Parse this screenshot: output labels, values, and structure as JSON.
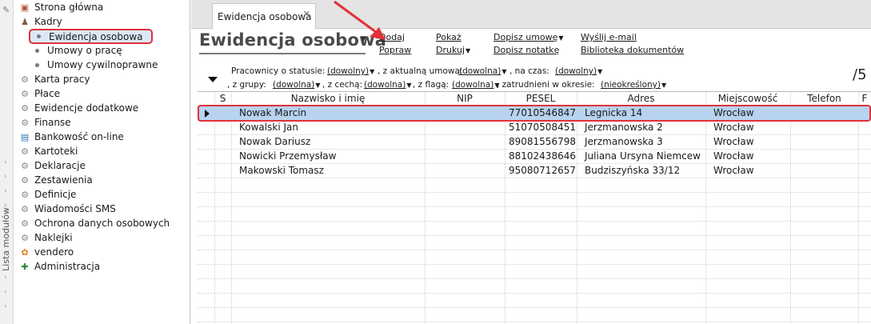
{
  "rail": {
    "label": "Lista modułów"
  },
  "sidebar": {
    "items": [
      {
        "label": "Strona główna",
        "icon": "home-icon"
      },
      {
        "label": "Kadry",
        "icon": "people-icon"
      },
      {
        "label": "Karta pracy",
        "icon": "gear-icon"
      },
      {
        "label": "Płace",
        "icon": "gear-icon"
      },
      {
        "label": "Ewidencje dodatkowe",
        "icon": "gear-icon"
      },
      {
        "label": "Finanse",
        "icon": "finance-icon"
      },
      {
        "label": "Bankowość on-line",
        "icon": "bank-icon"
      },
      {
        "label": "Kartoteki",
        "icon": "gear-icon"
      },
      {
        "label": "Deklaracje",
        "icon": "document-icon"
      },
      {
        "label": "Zestawienia",
        "icon": "gear-icon"
      },
      {
        "label": "Definicje",
        "icon": "gear-icon"
      },
      {
        "label": "Wiadomości SMS",
        "icon": "sms-icon"
      },
      {
        "label": "Ochrona danych osobowych",
        "icon": "gear-icon"
      },
      {
        "label": "Naklejki",
        "icon": "gear-icon"
      },
      {
        "label": "vendero",
        "icon": "vendero-icon"
      },
      {
        "label": "Administracja",
        "icon": "admin-icon"
      }
    ],
    "kadry_children": [
      {
        "label": "Ewidencja osobowa",
        "active": true
      },
      {
        "label": "Umowy o pracę",
        "active": false
      },
      {
        "label": "Umowy cywilnoprawne",
        "active": false
      }
    ]
  },
  "tab": {
    "label": "Ewidencja osobowa",
    "close": "✕"
  },
  "header": {
    "title": "Ewidencja osobowa",
    "actions": {
      "dodaj": "Dodaj",
      "popraw": "Popraw",
      "pokaz": "Pokaż",
      "drukuj": "Drukuj",
      "dopisz_umowe": "Dopisz umowę",
      "dopisz_notatke": "Dopisz notatkę",
      "wyslij_email": "Wyślij e-mail",
      "biblioteka": "Biblioteka dokumentów"
    }
  },
  "filters": {
    "status_label": "Pracownicy o statusie:",
    "status_value": "(dowolny)",
    "contract_label": ", z aktualną umową:",
    "contract_value": "(dowolna)",
    "time_label": ", na czas:",
    "time_value": "(dowolny)",
    "group_label": ", z grupy:",
    "group_value": "(dowolna)",
    "feature_label": ", z cechą:",
    "feature_value": "(dowolna)",
    "flag_label": ", z flagą:",
    "flag_value": "(dowolna)",
    "period_label": ", zatrudnieni w okresie:",
    "period_value": "(nieokreślony)",
    "counter": "/5"
  },
  "grid": {
    "columns": [
      "S",
      "Nazwisko i imię",
      "NIP",
      "PESEL",
      "Adres",
      "Miejscowość",
      "Telefon",
      "F"
    ],
    "rows": [
      {
        "name": "Nowak Marcin",
        "nip": "",
        "pesel": "77010546847",
        "address": "Legnicka 14",
        "city": "Wrocław",
        "phone": ""
      },
      {
        "name": "Kowalski Jan",
        "nip": "",
        "pesel": "51070508451",
        "address": "Jerzmanowska 2",
        "city": "Wrocław",
        "phone": ""
      },
      {
        "name": "Nowak Dariusz",
        "nip": "",
        "pesel": "89081556798",
        "address": "Jerzmanowska 3",
        "city": "Wrocław",
        "phone": ""
      },
      {
        "name": "Nowicki Przemysław",
        "nip": "",
        "pesel": "88102438646",
        "address": "Juliana Ursyna Niemcew",
        "city": "Wrocław",
        "phone": ""
      },
      {
        "name": "Makowski Tomasz",
        "nip": "",
        "pesel": "95080712657",
        "address": "Budziszyńska 33/12",
        "city": "Wrocław",
        "phone": ""
      }
    ],
    "selected_index": 0
  },
  "colors": {
    "highlight": "#e0323a",
    "selection": "#b7d3ef",
    "active_nav": "#dbe9f7"
  }
}
